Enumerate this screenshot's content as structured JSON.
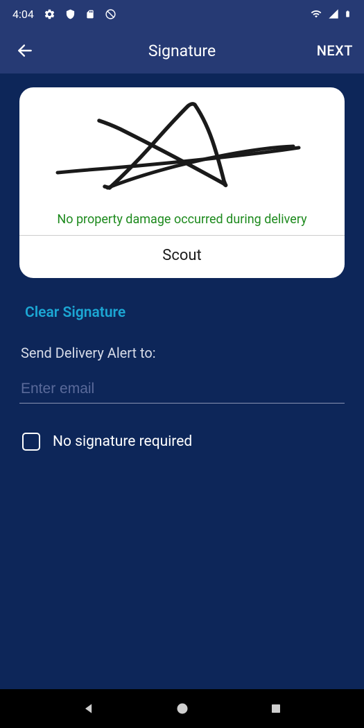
{
  "statusBar": {
    "time": "4:04"
  },
  "appBar": {
    "title": "Signature",
    "next": "NEXT"
  },
  "signatureCard": {
    "damageText": "No property damage occurred during delivery",
    "nameText": "Scout"
  },
  "clearSignature": "Clear Signature",
  "alertLabel": "Send Delivery Alert to:",
  "emailPlaceholder": "Enter email",
  "emailValue": "",
  "noSignatureLabel": "No signature required"
}
